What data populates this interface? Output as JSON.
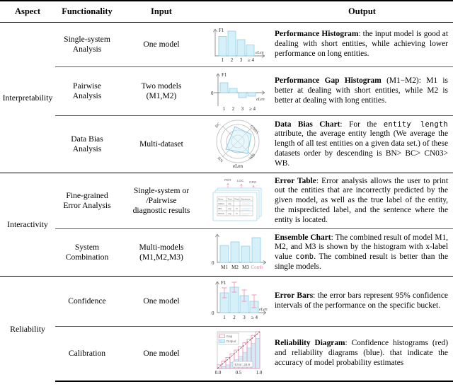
{
  "table": {
    "headers": {
      "aspect": "Aspect",
      "functionality": "Functionality",
      "input": "Input",
      "output": "Output"
    },
    "groups": [
      {
        "aspect": "Interpretability",
        "rows": [
          {
            "functionality": "Single-system\nAnalysis",
            "input": "One model",
            "vis": "performance-histogram",
            "output_title": "Performance Histogram",
            "output_text": ": the input model is good at dealing with short entities, while achieving lower performance on long entities."
          },
          {
            "functionality": "Pairwise\nAnalysis",
            "input": "Two models\n(M1,M2)",
            "vis": "performance-gap-histogram",
            "output_title": "Performance Gap Histogram",
            "output_text": " (M1−M2): M1 is better at dealing with short entities, while M2 is better at dealing with long entities."
          },
          {
            "functionality": "Data Bias\nAnalysis",
            "input": "Multi-dataset",
            "vis": "data-bias-radar-chart",
            "output_title": "Data Bias Chart",
            "output_text_a": ": For the ",
            "output_mono": "entity length",
            "output_text_b": " attribute, the average entity length (We average the length of all test entities on a given data set.) of these datasets order by descending is BN> BC> CN03> WB."
          }
        ]
      },
      {
        "aspect": "Interactivity",
        "rows": [
          {
            "functionality": "Fine-grained\nError Analysis",
            "input": "Single-system or /Pairwise\ndiagnostic results",
            "vis": "error-table-documents",
            "output_title": "Error Table",
            "output_text": ": Error analysis allows the user to print out the entities that are incorrectly predicted by the given model, as well as the true label of the entity, the mispredicted label, and the sentence where the entity is located."
          },
          {
            "functionality": "System\nCombination",
            "input": "Multi-models\n(M1,M2,M3)",
            "vis": "ensemble-chart",
            "output_title": "Ensemble Chart",
            "output_text_a": ": The combined result of model M1, M2, and M3 is shown by the histogram with x-label value ",
            "output_mono": "comb",
            "output_text_b": ". The combined result is better than the single models."
          }
        ]
      },
      {
        "aspect": "Reliability",
        "rows": [
          {
            "functionality": "Confidence",
            "input": "One model",
            "vis": "error-bars-chart",
            "output_title": "Error Bars",
            "output_text": ": the error bars represent 95% confidence intervals of the performance on the specific bucket."
          },
          {
            "functionality": "Calibration",
            "input": "One model",
            "vis": "reliability-diagram",
            "output_title": "Reliability Diagram",
            "output_text": ": Confidence histograms (red) and reliability diagrams (blue). that indicate the accuracy of model probability estimates"
          }
        ]
      }
    ]
  },
  "chart_data": [
    {
      "id": "performance-histogram",
      "type": "bar",
      "title": "",
      "ylabel": "F1",
      "xlabel": "eLen",
      "categories": [
        "1",
        "2",
        "3",
        "≥ 4"
      ],
      "values": [
        0.72,
        0.92,
        0.6,
        0.4
      ],
      "ylim": [
        0,
        1
      ],
      "grid": false,
      "bar_color": "#d6f0fa"
    },
    {
      "id": "performance-gap-histogram",
      "type": "bar",
      "title": "",
      "ylabel": "F1",
      "xlabel": "eLen",
      "categories": [
        "1",
        "2",
        "3",
        "≥ 4"
      ],
      "values": [
        0.75,
        0.3,
        -0.35,
        -0.25
      ],
      "ylim": [
        -1,
        1
      ],
      "zero_label": "0",
      "grid": false,
      "bar_color": "#d6f0fa"
    },
    {
      "id": "data-bias-radar-chart",
      "type": "radar",
      "title": "",
      "xlabel": "eLen",
      "categories": [
        "BC",
        "CN03",
        "WB",
        "BN"
      ],
      "values": [
        0.62,
        0.55,
        0.5,
        0.72
      ],
      "rings": 3,
      "fill_color": "#d6f0fa"
    },
    {
      "id": "error-table-documents",
      "type": "table",
      "annotations": [
        "PER",
        "LOC",
        "ORG"
      ],
      "columns": [
        "Error",
        "True",
        "Pred",
        "Sentence"
      ],
      "rows": [
        [
          "Italian",
          "org",
          "",
          ""
        ],
        [
          "NFL",
          "org",
          "O",
          ""
        ],
        [
          "NCAA",
          "org",
          "O",
          ""
        ]
      ]
    },
    {
      "id": "ensemble-chart",
      "type": "bar",
      "title": "",
      "ylabel": "",
      "xlabel": "",
      "categories": [
        "M1",
        "M2",
        "M3",
        "Comb"
      ],
      "values": [
        0.62,
        0.72,
        0.6,
        0.86
      ],
      "ylim": [
        0,
        1
      ],
      "zero_label": "0",
      "grid": false,
      "bar_color": "#d6f0fa",
      "highlight_category": "Comb",
      "highlight_color": "#f07ca8"
    },
    {
      "id": "error-bars-chart",
      "type": "bar",
      "title": "",
      "ylabel": "F1",
      "xlabel": "eLen",
      "categories": [
        "1",
        "2",
        "3",
        "≥ 4"
      ],
      "values": [
        0.7,
        0.88,
        0.6,
        0.38
      ],
      "errors": [
        0.13,
        0.11,
        0.15,
        0.17
      ],
      "ylim": [
        0,
        1
      ],
      "zero_label": "0",
      "grid": false,
      "bar_color": "#d6f0fa",
      "error_color": "#f295b8"
    },
    {
      "id": "reliability-diagram",
      "type": "bar",
      "title": "",
      "legend": [
        "Gap",
        "Output"
      ],
      "legend_position": "top-left",
      "annotation": "Error: 28.6",
      "xticks": [
        "0.0",
        "0.5",
        "1.0"
      ],
      "xlim": [
        0,
        1
      ],
      "ylim": [
        0,
        1
      ],
      "bins": [
        0.05,
        0.15,
        0.25,
        0.35,
        0.45,
        0.55,
        0.65,
        0.75,
        0.85,
        0.95
      ],
      "output_values": [
        0.02,
        0.05,
        0.1,
        0.16,
        0.24,
        0.33,
        0.44,
        0.56,
        0.68,
        0.82
      ],
      "gap_values": [
        0.1,
        0.2,
        0.3,
        0.4,
        0.5,
        0.6,
        0.7,
        0.8,
        0.9,
        1.0
      ],
      "gap_color": "#f295b8",
      "output_color": "#cfeefa"
    }
  ]
}
